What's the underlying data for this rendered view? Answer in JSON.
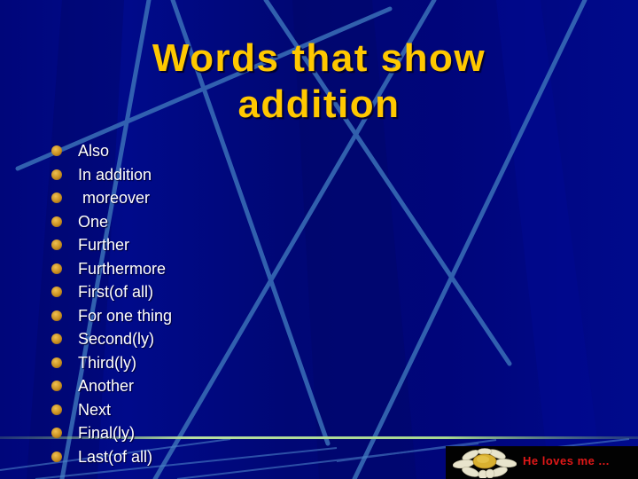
{
  "slide": {
    "title_line1": "Words that show",
    "title_line2": "addition",
    "bullets": [
      "Also",
      "In addition",
      " moreover",
      "One",
      "Further",
      "Furthermore",
      "First(of all)",
      "For one thing",
      "Second(ly)",
      "Third(ly)",
      "Another",
      "Next",
      "Final(ly)",
      "Last(of all)"
    ],
    "bullet_icon": "gold-sphere-bullet",
    "footer_banner": {
      "icon": "daisy-flower-icon",
      "text": "He loves me ..."
    },
    "colors": {
      "background": "#000a80",
      "title": "#ffc800",
      "body_text": "#ffffff",
      "banner_text": "#e01818",
      "accent_line": "#a8d890"
    }
  }
}
